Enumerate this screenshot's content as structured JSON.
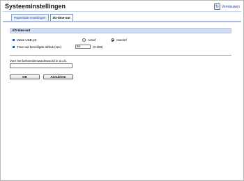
{
  "page": {
    "title": "Systeeminstellingen",
    "refresh_label": "Vernieuwen"
  },
  "tabs": [
    {
      "label": "Papierlade-instellingen",
      "active": false
    },
    {
      "label": "I/O-time-out",
      "active": true
    }
  ],
  "section": {
    "title": "I/O-time-out",
    "rows": {
      "fixed_usb": {
        "label": "Vaste USB-prt",
        "options": [
          "Actief",
          "Inactief"
        ],
        "selected": "Inactief"
      },
      "timeout": {
        "label": "Time-out beveiligde afdruk (sec)",
        "value": "60",
        "hint": "(0-300)"
      }
    }
  },
  "password": {
    "label": "Voer het beheerderswachtwoord in a.u.b.",
    "value": ""
  },
  "buttons": {
    "ok": "OK",
    "cancel": "Annuleren"
  }
}
